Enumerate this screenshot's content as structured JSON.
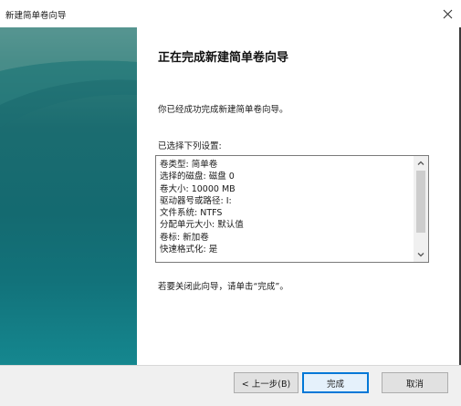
{
  "window": {
    "title": "新建简单卷向导"
  },
  "page": {
    "heading": "正在完成新建简单卷向导",
    "success_text": "你已经成功完成新建简单卷向导。",
    "settings_label": "已选择下列设置:",
    "settings": [
      "卷类型: 简单卷",
      "选择的磁盘: 磁盘 0",
      "卷大小: 10000 MB",
      "驱动器号或路径: I:",
      "文件系统: NTFS",
      "分配单元大小: 默认值",
      "卷标: 新加卷",
      "快速格式化: 是"
    ],
    "finish_hint": "若要关闭此向导，请单击“完成”。"
  },
  "buttons": {
    "back": "< 上一步(B)",
    "finish": "完成",
    "cancel": "取消"
  },
  "colors": {
    "accent": "#0078d7",
    "panel_top": "#4d8f8c",
    "panel_mid": "#146a70",
    "panel_bottom": "#15878f"
  }
}
